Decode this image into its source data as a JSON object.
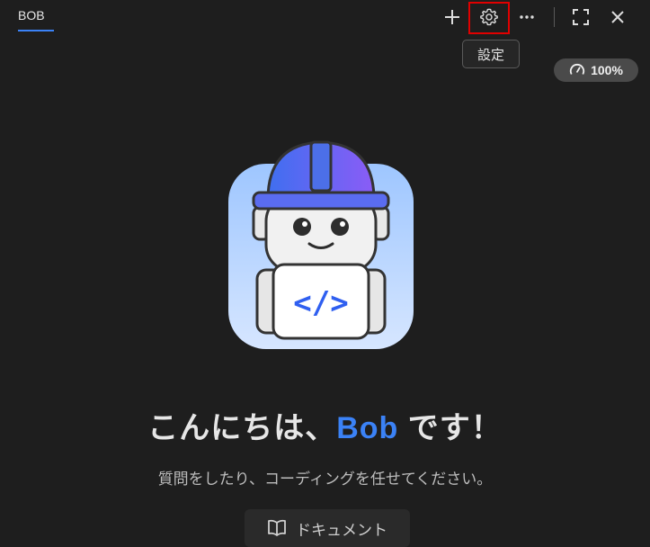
{
  "tab": {
    "label": "BOB"
  },
  "toolbar": {
    "icons": [
      "plus-icon",
      "gear-icon",
      "more-icon",
      "fullscreen-icon",
      "close-icon"
    ]
  },
  "tooltip": {
    "text": "設定"
  },
  "speed": {
    "value": "100%"
  },
  "greeting": {
    "prefix": "こんにちは、",
    "name": "Bob",
    "suffix": " です！"
  },
  "subtitle": "質問をしたり、コーディングを任せてください。",
  "doc_button": {
    "label": "ドキュメント"
  },
  "colors": {
    "accent": "#3b82f6",
    "highlight": "#e00000",
    "background": "#1e1e1e"
  }
}
